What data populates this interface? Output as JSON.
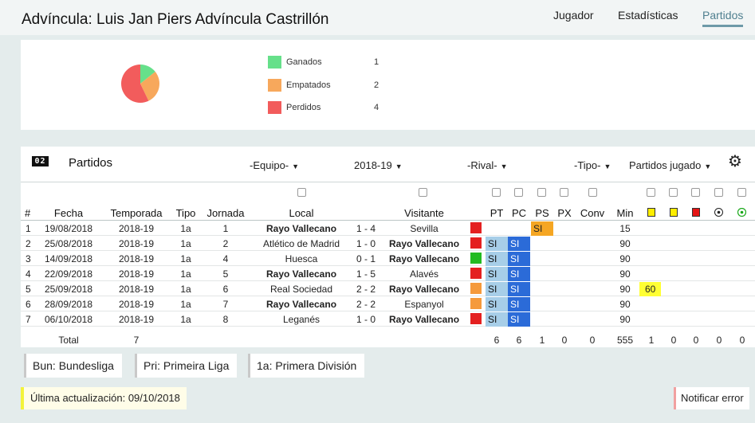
{
  "page": {
    "title": "Advíncula: Luis Jan Piers Advíncula Castrillón"
  },
  "nav": [
    {
      "label": "Jugador",
      "active": false
    },
    {
      "label": "Estadísticas",
      "active": false
    },
    {
      "label": "Partidos",
      "active": true
    }
  ],
  "summary": {
    "legend": [
      {
        "label": "Ganados",
        "count": "1",
        "color": "#66e08a"
      },
      {
        "label": "Empatados",
        "count": "2",
        "color": "#f7a85c"
      },
      {
        "label": "Perdidos",
        "count": "4",
        "color": "#f25c5c"
      }
    ]
  },
  "chart_data": {
    "type": "pie",
    "categories": [
      "Ganados",
      "Empatados",
      "Perdidos"
    ],
    "values": [
      1,
      2,
      4
    ],
    "colors": [
      "#66e08a",
      "#f7a85c",
      "#f25c5c"
    ]
  },
  "partidos": {
    "icon_text": "02",
    "title": "Partidos",
    "filters": {
      "equipo": "-Equipo-",
      "temporada": "2018-19",
      "rival": "-Rival-",
      "tipo": "-Tipo-",
      "partidos": "Partidos jugado"
    },
    "headers": {
      "num": "#",
      "fecha": "Fecha",
      "temporada": "Temporada",
      "tipo": "Tipo",
      "jornada": "Jornada",
      "local": "Local",
      "visitante": "Visitante",
      "pt": "PT",
      "pc": "PC",
      "ps": "PS",
      "px": "PX",
      "conv": "Conv",
      "min": "Min"
    },
    "stat_icons": [
      "yellow-card",
      "yellow-card",
      "red-card",
      "ball",
      "green-ball"
    ],
    "rows": [
      {
        "num": "1",
        "fecha": "19/08/2018",
        "temporada": "2018-19",
        "tipo": "1a",
        "jornada": "1",
        "local": "Rayo Vallecano",
        "local_bold": true,
        "score": "1 - 4",
        "visitante": "Sevilla",
        "visitante_bold": false,
        "result": "perdido",
        "result_color": "#e42020",
        "pt": "",
        "pc": "",
        "ps": "SI",
        "min": "15",
        "yellow": ""
      },
      {
        "num": "2",
        "fecha": "25/08/2018",
        "temporada": "2018-19",
        "tipo": "1a",
        "jornada": "2",
        "local": "Atlético de Madrid",
        "local_bold": false,
        "score": "1 - 0",
        "visitante": "Rayo Vallecano",
        "visitante_bold": true,
        "result": "perdido",
        "result_color": "#e42020",
        "pt": "SI",
        "pc": "SI",
        "ps": "",
        "min": "90",
        "yellow": ""
      },
      {
        "num": "3",
        "fecha": "14/09/2018",
        "temporada": "2018-19",
        "tipo": "1a",
        "jornada": "4",
        "local": "Huesca",
        "local_bold": false,
        "score": "0 - 1",
        "visitante": "Rayo Vallecano",
        "visitante_bold": true,
        "result": "ganado",
        "result_color": "#22bb22",
        "pt": "SI",
        "pc": "SI",
        "ps": "",
        "min": "90",
        "yellow": ""
      },
      {
        "num": "4",
        "fecha": "22/09/2018",
        "temporada": "2018-19",
        "tipo": "1a",
        "jornada": "5",
        "local": "Rayo Vallecano",
        "local_bold": true,
        "score": "1 - 5",
        "visitante": "Alavés",
        "visitante_bold": false,
        "result": "perdido",
        "result_color": "#e42020",
        "pt": "SI",
        "pc": "SI",
        "ps": "",
        "min": "90",
        "yellow": ""
      },
      {
        "num": "5",
        "fecha": "25/09/2018",
        "temporada": "2018-19",
        "tipo": "1a",
        "jornada": "6",
        "local": "Real Sociedad",
        "local_bold": false,
        "score": "2 - 2",
        "visitante": "Rayo Vallecano",
        "visitante_bold": true,
        "result": "empatado",
        "result_color": "#f59a3c",
        "pt": "SI",
        "pc": "SI",
        "ps": "",
        "min": "90",
        "yellow": "60"
      },
      {
        "num": "6",
        "fecha": "28/09/2018",
        "temporada": "2018-19",
        "tipo": "1a",
        "jornada": "7",
        "local": "Rayo Vallecano",
        "local_bold": true,
        "score": "2 - 2",
        "visitante": "Espanyol",
        "visitante_bold": false,
        "result": "empatado",
        "result_color": "#f59a3c",
        "pt": "SI",
        "pc": "SI",
        "ps": "",
        "min": "90",
        "yellow": ""
      },
      {
        "num": "7",
        "fecha": "06/10/2018",
        "temporada": "2018-19",
        "tipo": "1a",
        "jornada": "8",
        "local": "Leganés",
        "local_bold": false,
        "score": "1 - 0",
        "visitante": "Rayo Vallecano",
        "visitante_bold": true,
        "result": "perdido",
        "result_color": "#e42020",
        "pt": "SI",
        "pc": "SI",
        "ps": "",
        "min": "90",
        "yellow": ""
      }
    ],
    "totals": {
      "label": "Total",
      "count": "7",
      "pt": "6",
      "pc": "6",
      "ps": "1",
      "px": "0",
      "conv": "0",
      "min": "555",
      "yellow1": "1",
      "yellow2": "0",
      "red": "0",
      "goals": "0",
      "goals2": "0"
    }
  },
  "abbreviations": [
    "Bun: Bundesliga",
    "Pri: Primeira Liga",
    "1a: Primera División"
  ],
  "footer": {
    "updated": "Última actualización: 09/10/2018",
    "report": "Notificar error"
  }
}
